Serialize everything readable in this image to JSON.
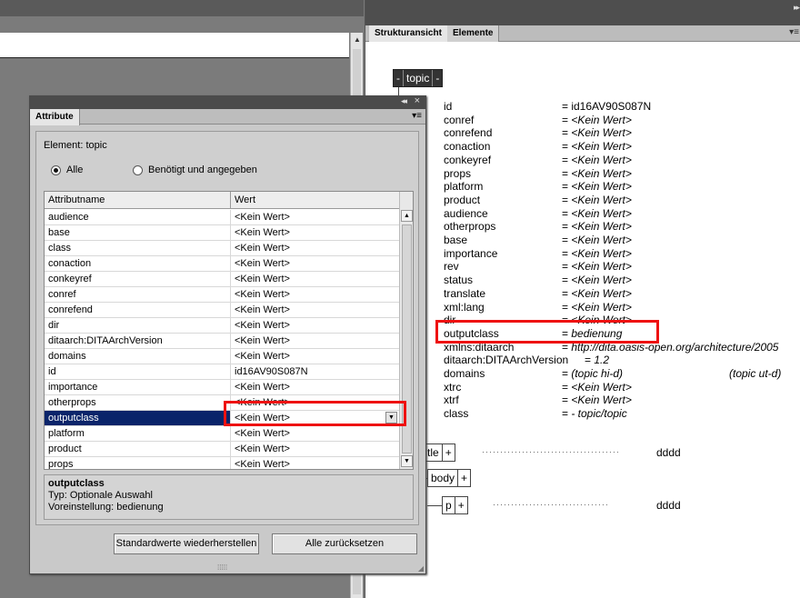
{
  "structure_panel": {
    "tabs": [
      "Strukturansicht",
      "Elemente"
    ],
    "topic_node": {
      "label": "topic",
      "collapse_left": "-",
      "collapse_right": "-"
    },
    "attributes": [
      {
        "name": "id",
        "value": "= id16AV90S087N",
        "italic": false
      },
      {
        "name": "conref",
        "value": "<Kein Wert>",
        "italic": true
      },
      {
        "name": "conrefend",
        "value": "<Kein Wert>",
        "italic": true
      },
      {
        "name": "conaction",
        "value": "<Kein Wert>",
        "italic": true
      },
      {
        "name": "conkeyref",
        "value": "<Kein Wert>",
        "italic": true
      },
      {
        "name": "props",
        "value": "<Kein Wert>",
        "italic": true
      },
      {
        "name": "platform",
        "value": "<Kein Wert>",
        "italic": true
      },
      {
        "name": "product",
        "value": "<Kein Wert>",
        "italic": true
      },
      {
        "name": "audience",
        "value": "<Kein Wert>",
        "italic": true
      },
      {
        "name": "otherprops",
        "value": "<Kein Wert>",
        "italic": true
      },
      {
        "name": "base",
        "value": "<Kein Wert>",
        "italic": true
      },
      {
        "name": "importance",
        "value": "<Kein Wert>",
        "italic": true
      },
      {
        "name": "rev",
        "value": "<Kein Wert>",
        "italic": true
      },
      {
        "name": "status",
        "value": "<Kein Wert>",
        "italic": true
      },
      {
        "name": "translate",
        "value": "<Kein Wert>",
        "italic": true
      },
      {
        "name": "xml:lang",
        "value": "<Kein Wert>",
        "italic": true
      },
      {
        "name": "dir",
        "value": "<Kein Wert>",
        "italic": true
      },
      {
        "name": "outputclass",
        "value": "bedienung",
        "italic": true
      },
      {
        "name": "xmlns:ditaarch",
        "value": "http://dita.oasis-open.org/architecture/2005",
        "italic": true
      },
      {
        "name": "ditaarch:DITAArchVersion",
        "value": "1.2",
        "italic": true
      },
      {
        "name": "domains",
        "value": "(topic hi-d)",
        "extra": "(topic ut-d)",
        "italic": true
      },
      {
        "name": "xtrc",
        "value": "<Kein Wert>",
        "italic": true
      },
      {
        "name": "xtrf",
        "value": "<Kein Wert>",
        "italic": true
      },
      {
        "name": "class",
        "value": "- topic/topic",
        "italic": true
      }
    ],
    "children": [
      {
        "label": "tle",
        "plus": "+",
        "text": "dddd"
      },
      {
        "label": "body",
        "plus": "+",
        "text": ""
      },
      {
        "label": "p",
        "plus": "+",
        "text": "dddd"
      }
    ]
  },
  "attribute_dialog": {
    "tab": "Attribute",
    "element_label": "Element: topic",
    "radio_all": "Alle",
    "radio_required": "Benötigt und angegeben",
    "col_name": "Attributname",
    "col_value": "Wert",
    "rows": [
      {
        "name": "audience",
        "value": "<Kein Wert>"
      },
      {
        "name": "base",
        "value": "<Kein Wert>"
      },
      {
        "name": "class",
        "value": "<Kein Wert>"
      },
      {
        "name": "conaction",
        "value": "<Kein Wert>"
      },
      {
        "name": "conkeyref",
        "value": "<Kein Wert>"
      },
      {
        "name": "conref",
        "value": "<Kein Wert>"
      },
      {
        "name": "conrefend",
        "value": "<Kein Wert>"
      },
      {
        "name": "dir",
        "value": "<Kein Wert>"
      },
      {
        "name": "ditaarch:DITAArchVersion",
        "value": "<Kein Wert>"
      },
      {
        "name": "domains",
        "value": "<Kein Wert>"
      },
      {
        "name": "id",
        "value": "id16AV90S087N"
      },
      {
        "name": "importance",
        "value": "<Kein Wert>"
      },
      {
        "name": "otherprops",
        "value": "<Kein Wert>"
      },
      {
        "name": "outputclass",
        "value": "<Kein Wert>",
        "selected": true
      },
      {
        "name": "platform",
        "value": "<Kein Wert>"
      },
      {
        "name": "product",
        "value": "<Kein Wert>"
      },
      {
        "name": "props",
        "value": "<Kein Wert>"
      }
    ],
    "info_title": "outputclass",
    "info_type": "Typ: Optionale Auswahl",
    "info_default": "Voreinstellung: bedienung",
    "btn_restore": "Standardwerte wiederherstellen",
    "btn_reset": "Alle zurücksetzen"
  },
  "colors": {
    "highlight": "#e11111",
    "selection": "#0a246a"
  }
}
